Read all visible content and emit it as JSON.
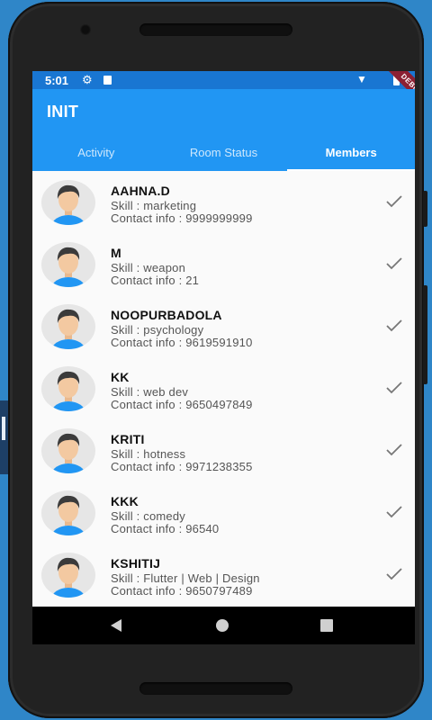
{
  "status_bar": {
    "time": "5:01",
    "debug_banner": "DEBUG"
  },
  "app": {
    "title": "INIT"
  },
  "tabs": [
    {
      "label": "Activity",
      "active": false
    },
    {
      "label": "Room Status",
      "active": false
    },
    {
      "label": "Members",
      "active": true
    }
  ],
  "members": [
    {
      "name": "AAHNA.D",
      "skill": "Skill :  marketing",
      "contact": "Contact info :  9999999999"
    },
    {
      "name": "M",
      "skill": "Skill :  weapon",
      "contact": "Contact info :  21"
    },
    {
      "name": "NOOPURBADOLA",
      "skill": "Skill :  psychology",
      "contact": "Contact info :  9619591910"
    },
    {
      "name": "KK",
      "skill": "Skill :  web dev",
      "contact": "Contact info :  9650497849"
    },
    {
      "name": "KRITI",
      "skill": "Skill :  hotness",
      "contact": "Contact info :  9971238355"
    },
    {
      "name": "KKK",
      "skill": "Skill :  comedy",
      "contact": "Contact info :  96540"
    },
    {
      "name": "KSHITIJ",
      "skill": "Skill :  Flutter | Web | Design",
      "contact": "Contact info :  9650797489"
    }
  ],
  "icons": {
    "status": [
      "gear-icon",
      "sd-card-icon",
      "wifi-icon",
      "battery-icon"
    ],
    "row_trailing": "check-icon",
    "nav": [
      "back-icon",
      "home-icon",
      "recents-icon"
    ]
  },
  "colors": {
    "primary": "#2196f3",
    "status_bar": "#1976d2",
    "debug_ribbon": "#8c2033",
    "avatar_shirt": "#2196f3",
    "avatar_skin": "#f3c9a1",
    "avatar_hair": "#3b3b3b"
  }
}
